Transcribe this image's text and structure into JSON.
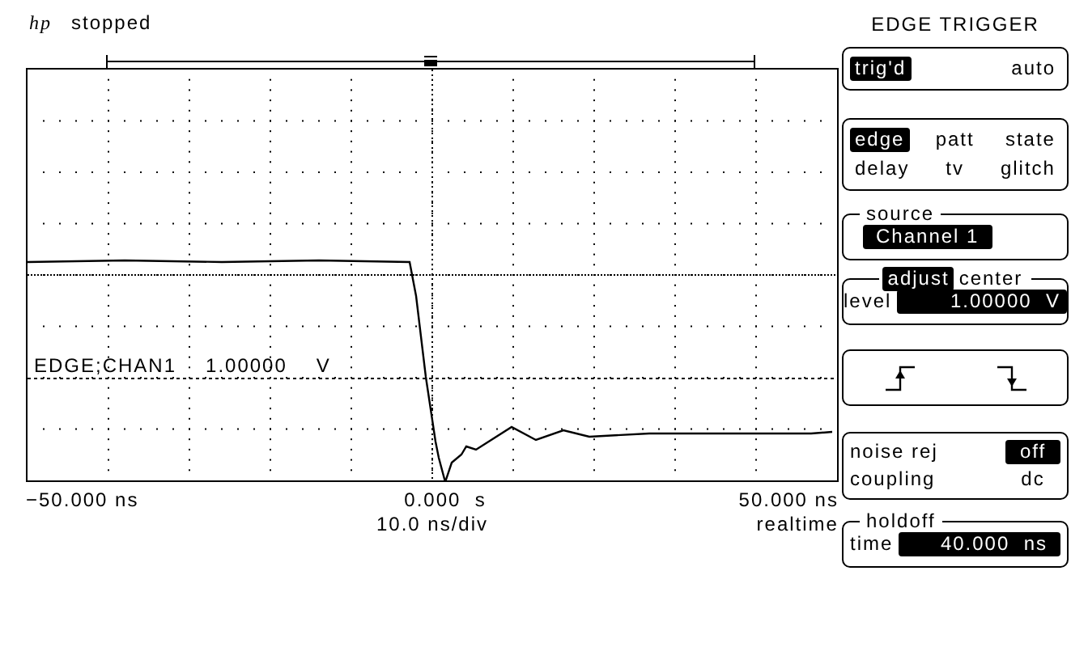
{
  "header": {
    "logo": "hp",
    "status": "stopped"
  },
  "display": {
    "trigger_source": "EDGE;CHAN1",
    "trigger_level": "1.00000",
    "trigger_unit": "V"
  },
  "time_axis": {
    "left": "−50.000 ns",
    "center": "0.000  s",
    "right": "50.000 ns",
    "scale": "10.0 ns/div",
    "mode": "realtime"
  },
  "menu": {
    "title": "EDGE TRIGGER",
    "sections": [
      {
        "kind": "options",
        "rows": [
          [
            {
              "label": "trig'd",
              "selected": true
            },
            {
              "label": "auto",
              "selected": false
            }
          ]
        ]
      },
      {
        "kind": "options",
        "rows": [
          [
            {
              "label": "edge",
              "selected": true
            },
            {
              "label": "patt",
              "selected": false
            },
            {
              "label": "state",
              "selected": false
            }
          ],
          [
            {
              "label": "delay",
              "selected": false
            },
            {
              "label": "tv",
              "selected": false
            },
            {
              "label": "glitch",
              "selected": false
            }
          ]
        ]
      },
      {
        "kind": "field",
        "legend": "source",
        "value": "Channel 1"
      },
      {
        "kind": "adjust",
        "legends": [
          {
            "label": "adjust",
            "selected": true
          },
          {
            "label": "center",
            "selected": false
          }
        ],
        "label": "level",
        "value": "1.00000  V"
      },
      {
        "kind": "slopes",
        "items": [
          {
            "kind": "rising"
          },
          {
            "kind": "falling"
          }
        ]
      },
      {
        "kind": "settings",
        "rows": [
          {
            "label": "noise rej",
            "value": "off",
            "highlighted": true
          },
          {
            "label": "coupling",
            "value": "dc",
            "highlighted": false
          }
        ]
      },
      {
        "kind": "field",
        "legend": "holdoff",
        "label": "time",
        "value": "40.000  ns"
      }
    ]
  }
}
